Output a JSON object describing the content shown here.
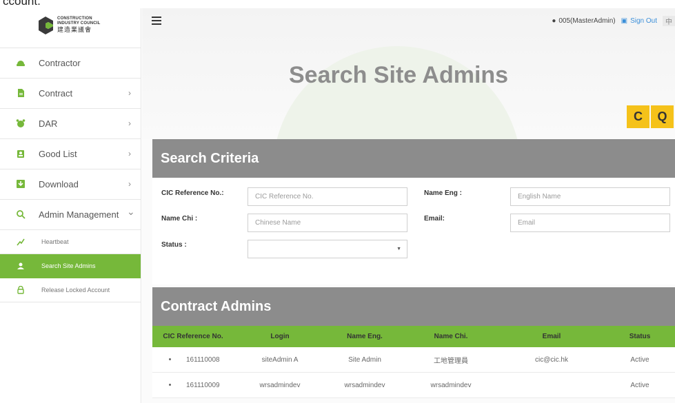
{
  "top_fragment": "ccount.",
  "logo": {
    "line1": "CONSTRUCTION",
    "line2": "INDUSTRY COUNCIL",
    "zh": "建造業議會"
  },
  "sidebar": {
    "items": [
      {
        "label": "Contractor",
        "icon": "helmet-icon",
        "has_chevron": false
      },
      {
        "label": "Contract",
        "icon": "document-icon",
        "has_chevron": true
      },
      {
        "label": "DAR",
        "icon": "alarm-icon",
        "has_chevron": true
      },
      {
        "label": "Good List",
        "icon": "badge-icon",
        "has_chevron": true
      },
      {
        "label": "Download",
        "icon": "download-icon",
        "has_chevron": true
      },
      {
        "label": "Admin Management",
        "icon": "search-icon",
        "has_chevron": true,
        "expanded": true
      }
    ],
    "sub_items": [
      {
        "label": "Heartbeat",
        "icon": "heartbeat-icon",
        "active": false
      },
      {
        "label": "Search Site Admins",
        "icon": "user-icon",
        "active": true
      },
      {
        "label": "Release Locked Account",
        "icon": "lock-icon",
        "active": false
      }
    ],
    "chevron_right": "›",
    "chevron_down": "⌄"
  },
  "header": {
    "user": "005(MasterAdmin)",
    "sign_out": "Sign Out",
    "lang": "中"
  },
  "page_title": "Search Site Admins",
  "buttons": {
    "refresh": "C",
    "search": "Q"
  },
  "criteria": {
    "title": "Search Criteria",
    "cic_label": "CIC Reference No.:",
    "cic_placeholder": "CIC Reference No.",
    "name_eng_label": "Name Eng :",
    "name_eng_placeholder": "English Name",
    "name_chi_label": "Name Chi :",
    "name_chi_placeholder": "Chinese Name",
    "email_label": "Email:",
    "email_placeholder": "Email",
    "status_label": "Status :",
    "status_value": ""
  },
  "contract_admins": {
    "title": "Contract Admins",
    "columns": [
      "CIC Reference No.",
      "Login",
      "Name Eng.",
      "Name Chi.",
      "Email",
      "Status"
    ],
    "rows": [
      [
        "161110008",
        "siteAdmin A",
        "Site Admin",
        "工地管理員",
        "cic@cic.hk",
        "Active"
      ],
      [
        "161110009",
        "wrsadmindev",
        "wrsadmindev",
        "wrsadmindev",
        "",
        "Active"
      ]
    ]
  },
  "colors": {
    "green": "#76b83a",
    "yellow": "#f5c21a",
    "grey_header": "#8c8c8c",
    "link": "#3b8fd9"
  }
}
